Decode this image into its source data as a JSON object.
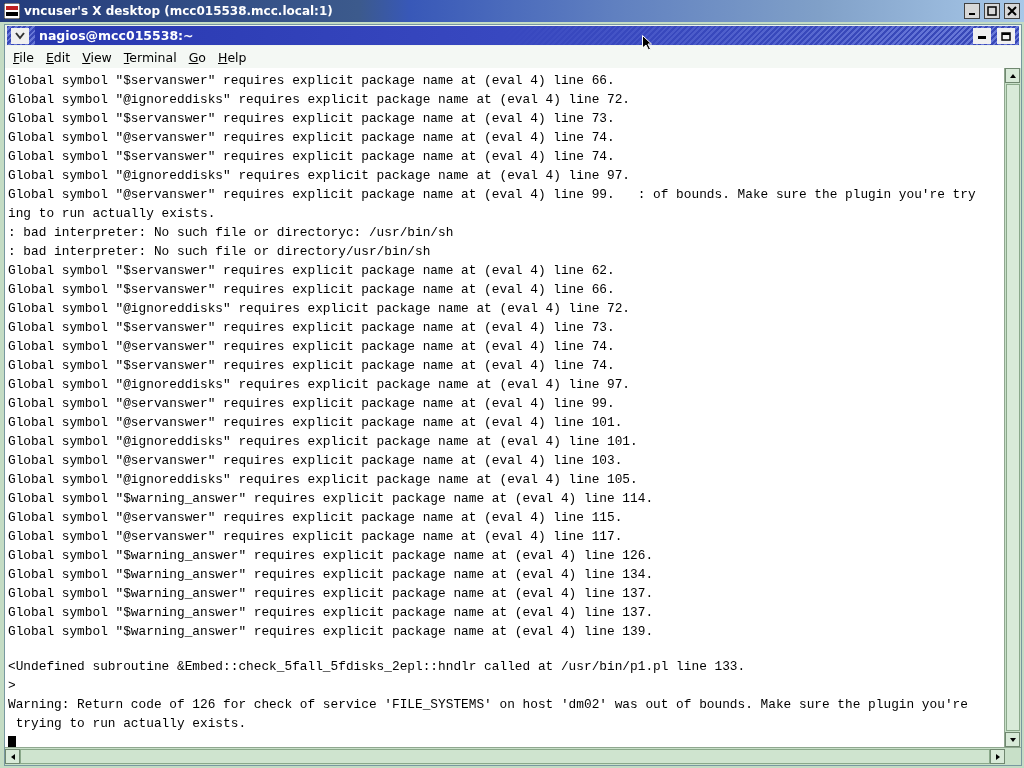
{
  "window": {
    "title": "vncuser's X desktop (mcc015538.mcc.local:1)"
  },
  "terminal_window": {
    "title": "nagios@mcc015538:~"
  },
  "menu": [
    {
      "label": "File"
    },
    {
      "label": "Edit"
    },
    {
      "label": "View"
    },
    {
      "label": "Terminal"
    },
    {
      "label": "Go"
    },
    {
      "label": "Help"
    }
  ],
  "terminal": {
    "lines": [
      "Global symbol \"$servanswer\" requires explicit package name at (eval 4) line 66.",
      "Global symbol \"@ignoreddisks\" requires explicit package name at (eval 4) line 72.",
      "Global symbol \"$servanswer\" requires explicit package name at (eval 4) line 73.",
      "Global symbol \"@servanswer\" requires explicit package name at (eval 4) line 74.",
      "Global symbol \"$servanswer\" requires explicit package name at (eval 4) line 74.",
      "Global symbol \"@ignoreddisks\" requires explicit package name at (eval 4) line 97.",
      "Global symbol \"@servanswer\" requires explicit package name at (eval 4) line 99.   : of bounds. Make sure the plugin you're try",
      "ing to run actually exists.",
      ": bad interpreter: No such file or directoryc: /usr/bin/sh",
      ": bad interpreter: No such file or directory/usr/bin/sh",
      "Global symbol \"$servanswer\" requires explicit package name at (eval 4) line 62.",
      "Global symbol \"$servanswer\" requires explicit package name at (eval 4) line 66.",
      "Global symbol \"@ignoreddisks\" requires explicit package name at (eval 4) line 72.",
      "Global symbol \"$servanswer\" requires explicit package name at (eval 4) line 73.",
      "Global symbol \"@servanswer\" requires explicit package name at (eval 4) line 74.",
      "Global symbol \"$servanswer\" requires explicit package name at (eval 4) line 74.",
      "Global symbol \"@ignoreddisks\" requires explicit package name at (eval 4) line 97.",
      "Global symbol \"@servanswer\" requires explicit package name at (eval 4) line 99.",
      "Global symbol \"@servanswer\" requires explicit package name at (eval 4) line 101.",
      "Global symbol \"@ignoreddisks\" requires explicit package name at (eval 4) line 101.",
      "Global symbol \"@servanswer\" requires explicit package name at (eval 4) line 103.",
      "Global symbol \"@ignoreddisks\" requires explicit package name at (eval 4) line 105.",
      "Global symbol \"$warning_answer\" requires explicit package name at (eval 4) line 114.",
      "Global symbol \"@servanswer\" requires explicit package name at (eval 4) line 115.",
      "Global symbol \"@servanswer\" requires explicit package name at (eval 4) line 117.",
      "Global symbol \"$warning_answer\" requires explicit package name at (eval 4) line 126.",
      "Global symbol \"$warning_answer\" requires explicit package name at (eval 4) line 134.",
      "Global symbol \"$warning_answer\" requires explicit package name at (eval 4) line 137.",
      "Global symbol \"$warning_answer\" requires explicit package name at (eval 4) line 137.",
      "Global symbol \"$warning_answer\" requires explicit package name at (eval 4) line 139."
    ],
    "lines_after_blank": [
      "<Undefined subroutine &Embed::check_5fall_5fdisks_2epl::hndlr called at /usr/bin/p1.pl line 133.",
      ">",
      "Warning: Return code of 126 for check of service 'FILE_SYSTEMS' on host 'dm02' was out of bounds. Make sure the plugin you're",
      " trying to run actually exists."
    ],
    "cursor": true
  }
}
